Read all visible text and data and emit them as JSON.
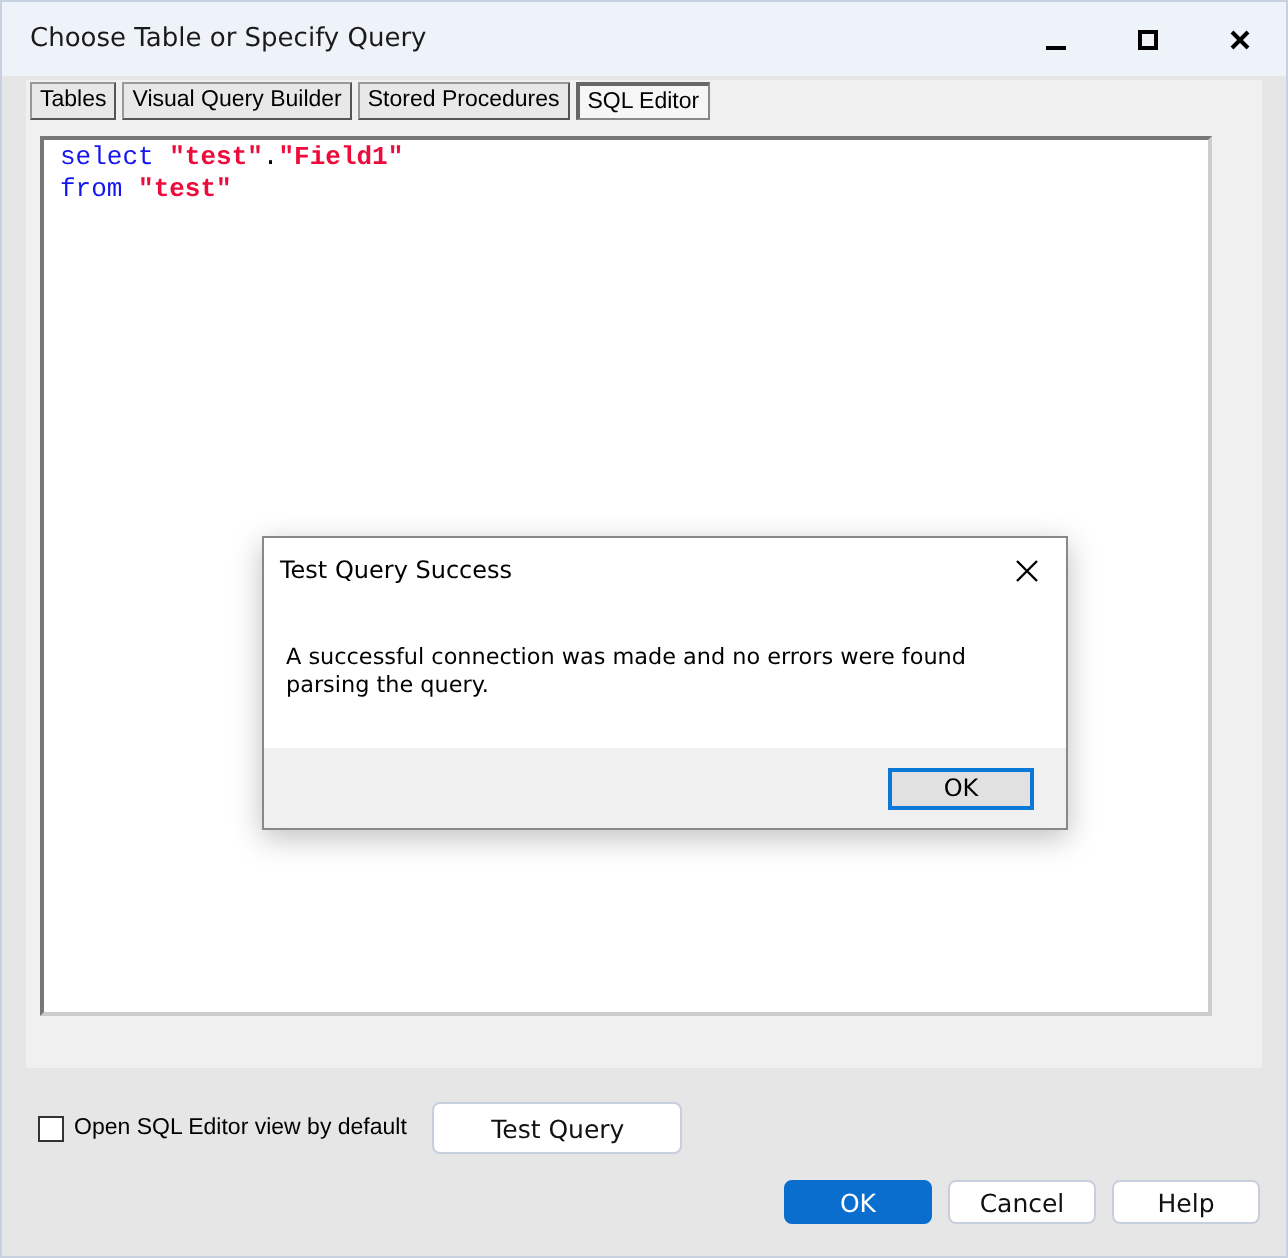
{
  "window": {
    "title": "Choose Table or Specify Query"
  },
  "tabs": [
    {
      "label": "Tables",
      "selected": false
    },
    {
      "label": "Visual Query Builder",
      "selected": false
    },
    {
      "label": "Stored Procedures",
      "selected": false
    },
    {
      "label": "SQL Editor",
      "selected": true
    }
  ],
  "editor": {
    "lines": [
      [
        {
          "kind": "keyword",
          "text": "select"
        },
        {
          "kind": "string",
          "text": "\"test\""
        },
        {
          "kind": "punct",
          "text": "."
        },
        {
          "kind": "string",
          "text": "\"Field1\""
        }
      ],
      [
        {
          "kind": "keyword",
          "text": "from"
        },
        {
          "kind": "string",
          "text": "\"test\""
        }
      ]
    ]
  },
  "message_box": {
    "title": "Test Query Success",
    "message": "A successful connection was made and no errors were found parsing the query.",
    "button": "OK"
  },
  "default_view_checkbox": {
    "label": "Open SQL Editor view by default",
    "checked": false
  },
  "test_query_button": "Test Query",
  "buttons": [
    {
      "label": "OK",
      "primary": true
    },
    {
      "label": "Cancel",
      "primary": false
    },
    {
      "label": "Help",
      "primary": false
    }
  ]
}
